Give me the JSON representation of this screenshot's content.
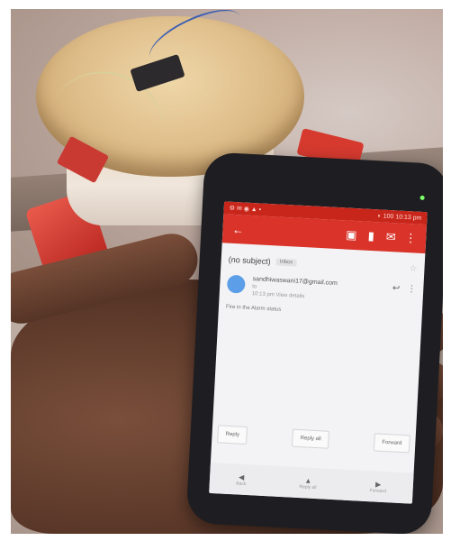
{
  "status_bar": {
    "left_icons": "⚙ ✉ ◉ ▲ •",
    "right": "◐ 100 10:13 pm"
  },
  "toolbar": {
    "back_icon": "arrow-left",
    "icons": [
      "archive-icon",
      "delete-icon",
      "mail-icon",
      "more-vert-icon"
    ]
  },
  "email": {
    "subject": "(no subject)",
    "label": "Inbox",
    "sender": "sandhiwaswani17@gmail.com",
    "to": "to",
    "recipient_line": "10:13 pm  View details",
    "body": "Fire in the  Alarm status"
  },
  "actions": [
    "Reply",
    "Reply all",
    "Forward"
  ],
  "nav": [
    "Back",
    "Reply all",
    "Forward"
  ],
  "colors": {
    "accent": "#d9332a",
    "avatar": "#5c9ee8"
  }
}
